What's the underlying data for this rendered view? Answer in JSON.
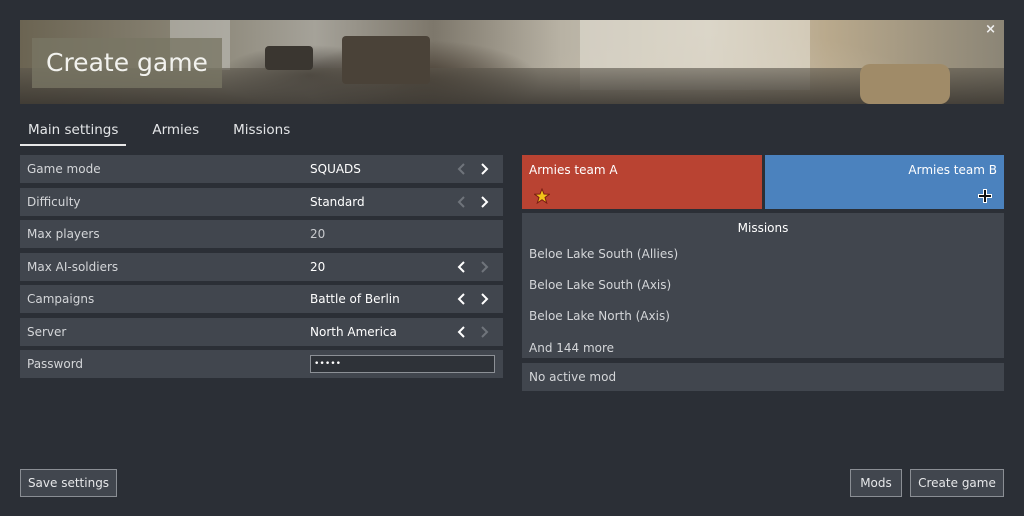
{
  "header": {
    "title": "Create game",
    "close_glyph": "×"
  },
  "tabs": [
    {
      "label": "Main settings",
      "active": true
    },
    {
      "label": "Armies",
      "active": false
    },
    {
      "label": "Missions",
      "active": false
    }
  ],
  "settings": [
    {
      "label": "Game mode",
      "value": "SQUADS",
      "left_enabled": false,
      "right_enabled": true
    },
    {
      "label": "Difficulty",
      "value": "Standard",
      "left_enabled": false,
      "right_enabled": true
    },
    {
      "label": "Max players",
      "value": "20"
    },
    {
      "label": "Max AI-soldiers",
      "value": "20",
      "left_enabled": true,
      "right_enabled": false
    },
    {
      "label": "Campaigns",
      "value": "Battle of Berlin",
      "left_enabled": true,
      "right_enabled": true
    },
    {
      "label": "Server",
      "value": "North America",
      "left_enabled": true,
      "right_enabled": false
    },
    {
      "label": "Password",
      "value": "•••••"
    }
  ],
  "teams": {
    "a": {
      "label": "Armies team A",
      "icon": "star-icon",
      "color": "#b94332"
    },
    "b": {
      "label": "Armies team B",
      "icon": "iron-cross-icon",
      "color": "#4b82be"
    }
  },
  "missions": {
    "header": "Missions",
    "items": [
      "Beloe Lake South (Allies)",
      "Beloe Lake South (Axis)",
      "Beloe Lake North (Axis)"
    ],
    "more": "And 144 more"
  },
  "mod": {
    "label": "No active mod"
  },
  "buttons": {
    "save": "Save settings",
    "mods": "Mods",
    "create": "Create game"
  }
}
